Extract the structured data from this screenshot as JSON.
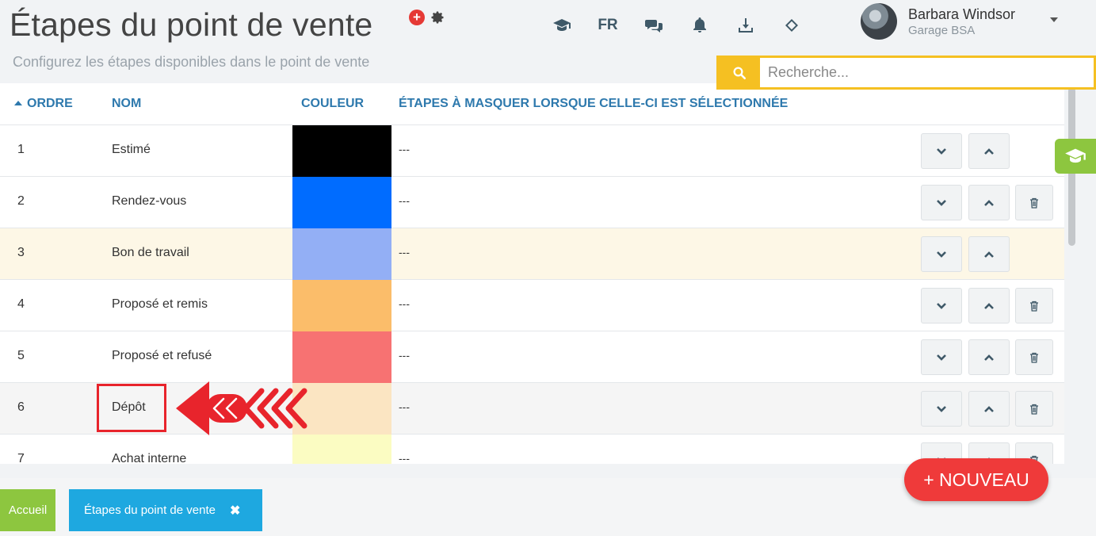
{
  "page": {
    "title": "Étapes du point de vente",
    "subtitle": "Configurez les étapes disponibles dans le point de vente"
  },
  "topbar": {
    "language": "FR",
    "user_name": "Barbara Windsor",
    "company": "Garage BSA"
  },
  "search": {
    "placeholder": "Recherche..."
  },
  "table": {
    "headers": {
      "order": "ORDRE",
      "name": "NOM",
      "color": "COULEUR",
      "hide": "ÉTAPES À MASQUER LORSQUE CELLE-CI EST SÉLECTIONNÉE"
    },
    "rows": [
      {
        "order": "1",
        "name": "Estimé",
        "color": "#000000",
        "hide": "---",
        "deletable": false
      },
      {
        "order": "2",
        "name": "Rendez-vous",
        "color": "#006cff",
        "hide": "---",
        "deletable": true
      },
      {
        "order": "3",
        "name": "Bon de travail",
        "color": "#93aff5",
        "hide": "---",
        "deletable": false
      },
      {
        "order": "4",
        "name": "Proposé et remis",
        "color": "#fbbd6a",
        "hide": "---",
        "deletable": true
      },
      {
        "order": "5",
        "name": "Proposé et refusé",
        "color": "#f77272",
        "hide": "---",
        "deletable": true
      },
      {
        "order": "6",
        "name": "Dépôt",
        "color": "#fbe5c2",
        "hide": "---",
        "deletable": true
      },
      {
        "order": "7",
        "name": "Achat interne",
        "color": "#fbfcc2",
        "hide": "---",
        "deletable": true
      }
    ]
  },
  "actions": {
    "new_label": "+ NOUVEAU"
  },
  "footer": {
    "home_tab": "Accueil",
    "current_tab": "Étapes du point de vente",
    "close_symbol": "✖"
  }
}
